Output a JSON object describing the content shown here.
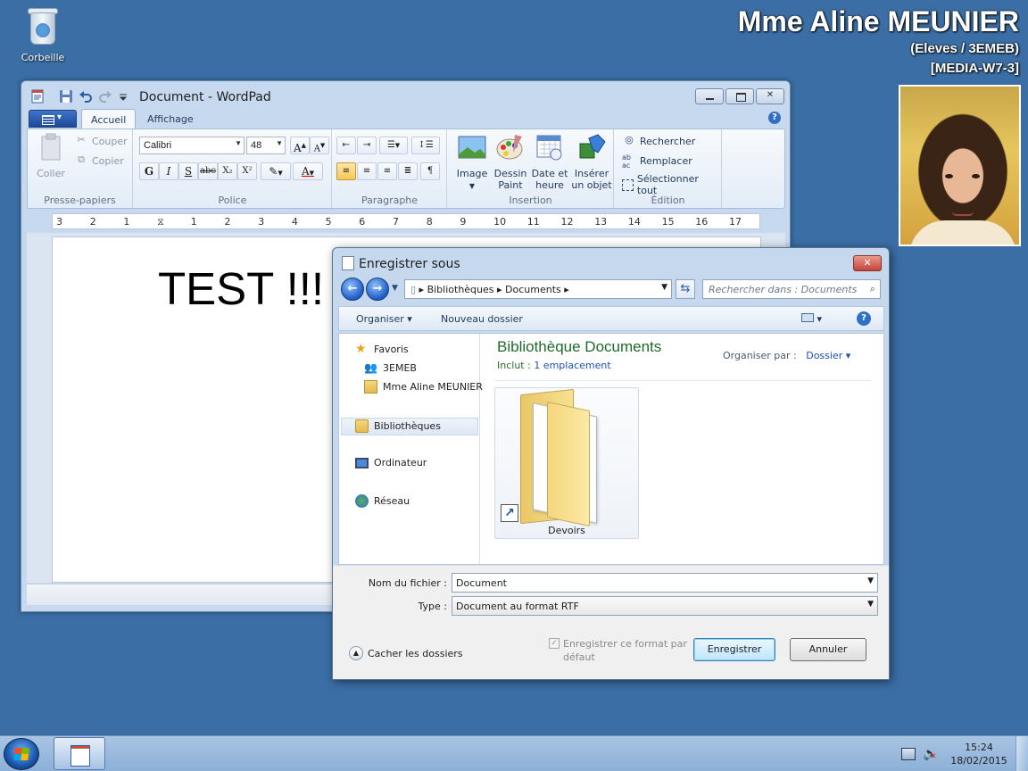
{
  "desktop": {
    "recycle_bin_label": "Corbeille",
    "user_name": "Mme Aline MEUNIER",
    "user_group": "(Eleves / 3EMEB)",
    "machine": "[MEDIA-W7-3]"
  },
  "wordpad": {
    "title": "Document - WordPad",
    "tabs": [
      "Accueil",
      "Affichage"
    ],
    "clipboard": {
      "paste": "Coller",
      "cut": "Couper",
      "copy": "Copier",
      "group": "Presse-papiers"
    },
    "font": {
      "family": "Calibri",
      "size": "48",
      "group": "Police"
    },
    "paragraph": {
      "group": "Paragraphe"
    },
    "insert": {
      "image": "Image",
      "paint_l1": "Dessin",
      "paint_l2": "Paint",
      "date_l1": "Date et",
      "date_l2": "heure",
      "object_l1": "Insérer",
      "object_l2": "un objet",
      "group": "Insertion"
    },
    "edit": {
      "find": "Rechercher",
      "replace": "Remplacer",
      "select_all": "Sélectionner tout",
      "group": "Édition"
    },
    "document_text": "TEST !!!"
  },
  "dialog": {
    "title": "Enregistrer sous",
    "breadcrumb": [
      "Bibliothèques",
      "Documents"
    ],
    "search_placeholder": "Rechercher dans : Documents",
    "toolbar": {
      "organize": "Organiser",
      "new_folder": "Nouveau dossier"
    },
    "nav": {
      "favorites": "Favoris",
      "fav_items": [
        "3EMEB",
        "Mme Aline MEUNIER"
      ],
      "libraries": "Bibliothèques",
      "computer": "Ordinateur",
      "network": "Réseau"
    },
    "library": {
      "title": "Bibliothèque Documents",
      "includes_label": "Inclut :",
      "includes_link": "1 emplacement",
      "arrange_label": "Organiser par :",
      "arrange_value": "Dossier"
    },
    "folder_label": "Devoirs",
    "filename_label": "Nom du fichier :",
    "filename_value": "Document",
    "type_label": "Type :",
    "type_value": "Document au format RTF",
    "hide_folders": "Cacher les dossiers",
    "save_default_l1": "Enregistrer ce format par",
    "save_default_l2": "défaut",
    "save_button": "Enregistrer",
    "cancel_button": "Annuler"
  },
  "taskbar": {
    "time": "15:24",
    "date": "18/02/2015"
  },
  "colors": {
    "desktop": "#3a6ea5",
    "accent": "#1f4fb3",
    "library_title": "#1e6a2c"
  }
}
